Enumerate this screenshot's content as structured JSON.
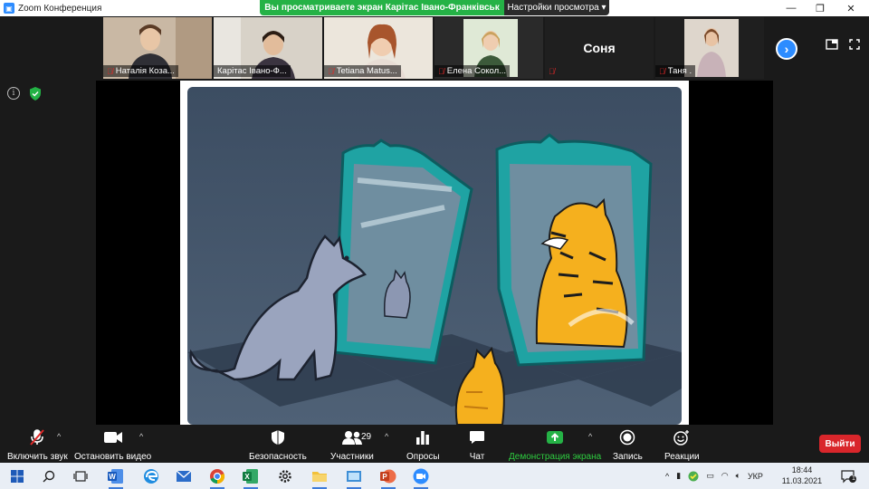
{
  "window": {
    "app_title": "Zoom Конференция",
    "minimize": "—",
    "restore": "❐",
    "close": "✕"
  },
  "share_banner": {
    "message": "Вы просматриваете экран Карітас Івано-Франківськ",
    "view_options": "Настройки просмотра ▾"
  },
  "participants_strip": [
    {
      "name": "Наталія Коза...",
      "muted": true,
      "has_video": true
    },
    {
      "name": "Карітас Івано-Ф...",
      "muted": false,
      "has_video": true,
      "active_speaker": true
    },
    {
      "name": "Tetiana Matus...",
      "muted": true,
      "has_video": true
    },
    {
      "name": "Елена Сокол...",
      "muted": true,
      "has_video": true
    },
    {
      "name": "Соня",
      "muted": true,
      "has_video": false
    },
    {
      "name": "Таня .",
      "muted": true,
      "has_video": true
    }
  ],
  "toolbar": {
    "unmute": "Включить звук",
    "stop_video": "Остановить видео",
    "security": "Безопасность",
    "participants": "Участники",
    "participants_count": "29",
    "polls": "Опросы",
    "chat": "Чат",
    "share_screen": "Демонстрация экрана",
    "record": "Запись",
    "reactions": "Реакции",
    "end": "Выйти"
  },
  "taskbar": {
    "language": "УКР",
    "time": "18:44",
    "date": "11.03.2021",
    "notification_count": "1",
    "apps": [
      "start",
      "search",
      "task-view",
      "word",
      "edge",
      "mail",
      "chrome",
      "excel",
      "settings",
      "explorer",
      "photos",
      "powerpoint",
      "zoom"
    ]
  },
  "colors": {
    "zoom_blue": "#2d8cff",
    "share_green": "#25b246",
    "end_red": "#d9262b",
    "mirror_teal": "#1fa3a3",
    "tiger_orange": "#f5b01e"
  }
}
